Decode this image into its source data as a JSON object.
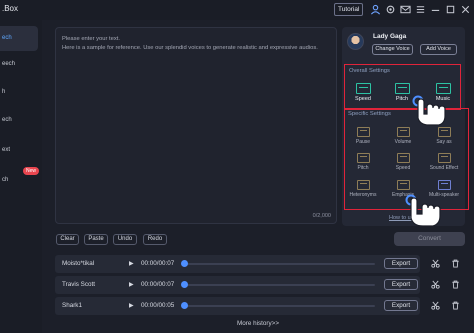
{
  "titlebar": {
    "app_title": ".Box",
    "tutorial_label": "Tutorial",
    "icons": [
      "user-icon",
      "gear-icon",
      "mail-icon",
      "menu-icon",
      "minimize-icon",
      "maximize-icon",
      "close-icon"
    ]
  },
  "sidebar": {
    "items": [
      {
        "label": "ech"
      },
      {
        "label": "eech"
      },
      {
        "label": "h"
      },
      {
        "label": "ech"
      },
      {
        "label": "ext"
      },
      {
        "label": "ch"
      }
    ],
    "badge": "New"
  },
  "editor": {
    "text": "Please enter your text.\nHere is a sample for reference. Use our splendid voices to generate realistic and expressive audios.",
    "char_count": "0/2,000"
  },
  "edit_buttons": {
    "clear": "Clear",
    "paste": "Paste",
    "undo": "Undo",
    "redo": "Redo"
  },
  "voice": {
    "name": "Lady Gaga",
    "change_voice": "Change Voice",
    "add_voice": "Add Voice"
  },
  "overall_settings": {
    "title": "Overall Settings",
    "options": [
      "Speed",
      "Pitch",
      "Music"
    ]
  },
  "specific_settings": {
    "title": "Specific Settings",
    "options": [
      "Pause",
      "Volume",
      "Say as",
      "Pitch",
      "Speed",
      "Sound Effect",
      "Heteronyms",
      "Emphasis",
      "Multi-speaker"
    ],
    "link": "How to use"
  },
  "convert_label": "Convert",
  "history": {
    "rows": [
      {
        "name": "Moisto*tikal",
        "time": "00:00/00:07",
        "export": "Export",
        "progress": 0
      },
      {
        "name": "Travis Scott",
        "time": "00:00/00:07",
        "export": "Export",
        "progress": 0
      },
      {
        "name": "Shark1",
        "time": "00:00/00:05",
        "export": "Export",
        "progress": 0
      }
    ],
    "more": "More history>>"
  },
  "colors": {
    "accent": "#4e8fff",
    "highlight_box": "#e0243a",
    "badge": "#e9464f",
    "teal_icon": "#2dc2a3"
  }
}
